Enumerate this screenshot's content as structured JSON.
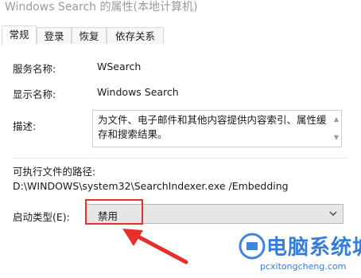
{
  "window": {
    "title": "Windows Search 的属性(本地计算机)"
  },
  "tabs": [
    {
      "label": "常规",
      "active": true
    },
    {
      "label": "登录",
      "active": false
    },
    {
      "label": "恢复",
      "active": false
    },
    {
      "label": "依存关系",
      "active": false
    }
  ],
  "general": {
    "service_name_label": "服务名称:",
    "service_name": "WSearch",
    "display_name_label": "显示名称:",
    "display_name": "Windows Search",
    "description_label": "描述:",
    "description": "为文件、电子邮件和其他内容提供内容索引、属性缓存和搜索结果。",
    "path_label": "可执行文件的路径:",
    "path": "D:\\WINDOWS\\system32\\SearchIndexer.exe /Embedding",
    "startup_type_label": "启动类型(E):",
    "startup_type_value": "禁用"
  },
  "annotation": {
    "color": "#e5302c"
  },
  "watermark": {
    "brand": "电脑系统城",
    "url": "pcxitongcheng.com",
    "color": "#1f6fd6"
  }
}
